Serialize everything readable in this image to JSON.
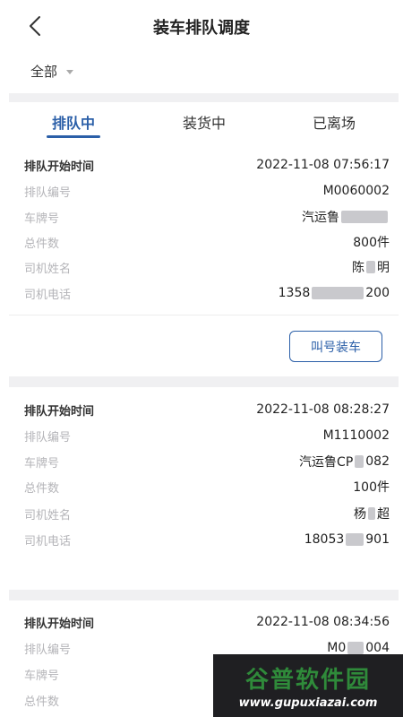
{
  "header": {
    "title": "装车排队调度"
  },
  "filter": {
    "label": "全部"
  },
  "tabs": [
    {
      "label": "排队中",
      "active": true
    },
    {
      "label": "装货中",
      "active": false
    },
    {
      "label": "已离场",
      "active": false
    }
  ],
  "labels": {
    "start_time": "排队开始时间",
    "queue_no": "排队编号",
    "plate": "车牌号",
    "total": "总件数",
    "driver": "司机姓名",
    "phone": "司机电话"
  },
  "cards": [
    {
      "start_time": "2022-11-08 07:56:17",
      "queue_no": "M0060002",
      "plate": "汽运鲁",
      "total": "800件",
      "driver_a": "陈",
      "driver_b": "明",
      "phone_a": "1358",
      "phone_b": "200",
      "action": "叫号装车"
    },
    {
      "start_time": "2022-11-08 08:28:27",
      "queue_no": "M1110002",
      "plate_a": "汽运鲁CP",
      "plate_b": "082",
      "total": "100件",
      "driver_a": "杨",
      "driver_b": "超",
      "phone_a": "18053",
      "phone_b": "901"
    },
    {
      "start_time": "2022-11-08 08:34:56",
      "queue_no_a": "M0",
      "queue_no_b": "004"
    }
  ],
  "watermark": {
    "main": "谷普软件园",
    "sub": "www.gupuxiazai.com"
  },
  "colors": {
    "accent": "#2b5fa8",
    "muted": "#b4b4b8",
    "watermark_green": "#2f8a3a"
  }
}
